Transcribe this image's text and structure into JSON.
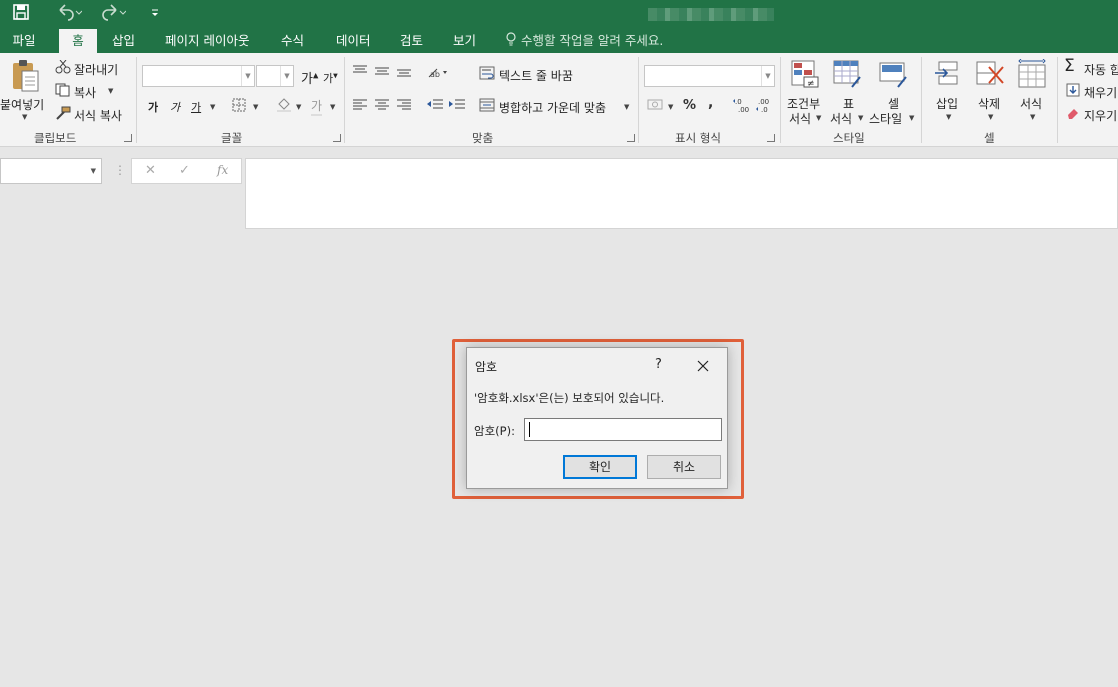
{
  "quick_access": {
    "save_icon": "save-icon",
    "undo_icon": "undo-icon",
    "redo_icon": "redo-icon",
    "customize_icon": "customize-icon"
  },
  "tabs": [
    {
      "label": "파일",
      "active": false
    },
    {
      "label": "홈",
      "active": true
    },
    {
      "label": "삽입",
      "active": false
    },
    {
      "label": "페이지 레이아웃",
      "active": false
    },
    {
      "label": "수식",
      "active": false
    },
    {
      "label": "데이터",
      "active": false
    },
    {
      "label": "검토",
      "active": false
    },
    {
      "label": "보기",
      "active": false
    }
  ],
  "tell_me": "수행할 작업을 알려 주세요.",
  "clipboard": {
    "paste": "붙여넣기",
    "cut": "잘라내기",
    "copy": "복사",
    "format_painter": "서식 복사",
    "group": "클립보드"
  },
  "font": {
    "grow": "가",
    "shrink": "가",
    "bold": "가",
    "italic": "가",
    "underline": "가",
    "font_color": "가",
    "group": "글꼴"
  },
  "alignment": {
    "wrap_text": "텍스트 줄 바꿈",
    "merge_center": "병합하고 가운데 맞춤",
    "group": "맞춤"
  },
  "number": {
    "percent": "%",
    "comma": ",",
    "inc_decimal": "←.0\n.00",
    "dec_decimal": ".00\n→.0",
    "group": "표시 형식"
  },
  "styles": {
    "conditional": [
      "조건부",
      "서식"
    ],
    "table": [
      "표",
      "서식"
    ],
    "cell": [
      "셀",
      "스타일"
    ],
    "group": "스타일"
  },
  "cells": {
    "insert": "삽입",
    "delete": "삭제",
    "format": "서식",
    "group": "셀"
  },
  "editing": {
    "autosum": "자동 합",
    "fill": "채우기",
    "clear": "지우기"
  },
  "formula_bar": {
    "cancel": "✕",
    "enter": "✓",
    "fx": "fx"
  },
  "dialog": {
    "title": "암호",
    "help": "?",
    "message": "'암호화.xlsx'은(는) 보호되어 있습니다.",
    "password_label": "암호(P):",
    "password_value": "",
    "ok": "확인",
    "cancel": "취소"
  },
  "colors": {
    "excel_green": "#217346",
    "highlight": "#e0603a",
    "focus_blue": "#0078d7"
  }
}
